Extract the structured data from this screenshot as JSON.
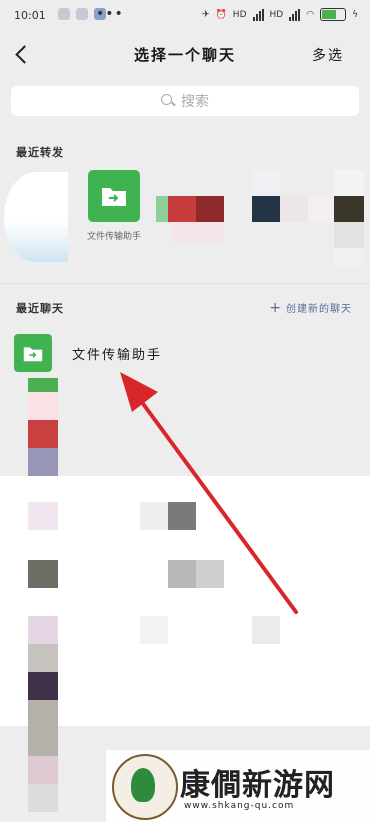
{
  "status_bar": {
    "time": "10:01",
    "dots": "•••",
    "hd1": "HD",
    "hd2": "HD"
  },
  "nav": {
    "title": "选择一个聊天",
    "multi_select": "多选"
  },
  "search": {
    "placeholder": "搜索"
  },
  "recent_forward": {
    "title": "最近转发",
    "items": [
      {
        "label": "文件传输助手"
      }
    ]
  },
  "recent_chats": {
    "title": "最近聊天",
    "create_new": "创建新的聊天",
    "items": [
      {
        "name": "文件传输助手"
      }
    ]
  },
  "watermark": {
    "name": "康僴新游网",
    "url": "www.shkang-qu.com"
  },
  "colors": {
    "folder_green": "#3fb350",
    "link_blue": "#576b95",
    "annotation_red": "#d9262a"
  }
}
